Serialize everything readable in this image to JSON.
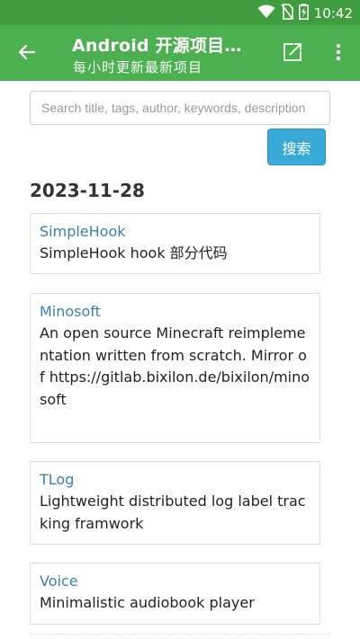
{
  "status_bar": {
    "time": "10:42",
    "icons": [
      "wifi-icon",
      "no-sim-icon",
      "battery-charging-icon"
    ]
  },
  "app_bar": {
    "title": "Android 开源项目…",
    "subtitle": "每小时更新最新项目",
    "back_icon": "back-arrow-icon",
    "share_icon": "share-icon",
    "more_icon": "more-vert-icon"
  },
  "search": {
    "placeholder": "Search title, tags, author, keywords, description",
    "value": "",
    "button_label": "搜索"
  },
  "date_heading": "2023-11-28",
  "projects": [
    {
      "title": "SimpleHook",
      "description": "SimpleHook hook 部分代码"
    },
    {
      "title": "Minosoft",
      "description": "An open source Minecraft reimplementation written from scratch. Mirror of https://gitlab.bixilon.de/bixilon/minosoft"
    },
    {
      "title": "TLog",
      "description": "Lightweight distributed log label tracking framwork"
    },
    {
      "title": "Voice",
      "description": "Minimalistic audiobook player"
    }
  ],
  "colors": {
    "status_bar": "#3f9c3f",
    "app_bar": "#4caf50",
    "search_button": "#39a9d8",
    "link": "#3b7fb8"
  }
}
